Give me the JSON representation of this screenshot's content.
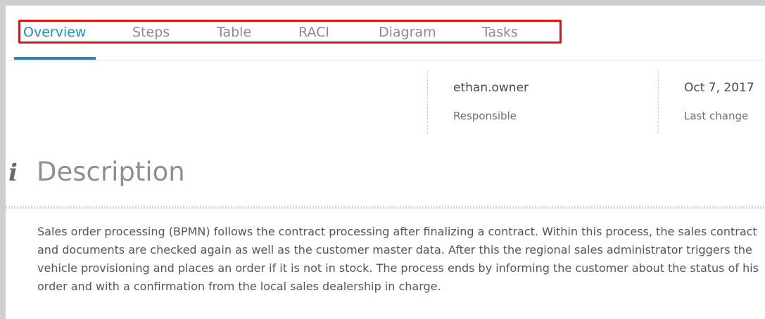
{
  "tabs": [
    {
      "label": "Overview",
      "active": true
    },
    {
      "label": "Steps",
      "active": false
    },
    {
      "label": "Table",
      "active": false
    },
    {
      "label": "RACI",
      "active": false
    },
    {
      "label": "Diagram",
      "active": false
    },
    {
      "label": "Tasks",
      "active": false
    }
  ],
  "meta": {
    "owner": {
      "value": "ethan.owner",
      "label": "Responsible"
    },
    "last_change": {
      "value": "Oct 7, 2017",
      "label": "Last change"
    }
  },
  "description": {
    "icon": "info-icon",
    "title": "Description",
    "text": "Sales order processing (BPMN) follows the contract processing after finalizing a contract. Within this process, the sales contract and documents are checked again as well as the customer master data. After this the regional sales administrator triggers the vehicle provisioning and places an order if it is not in stock. The process ends by informing the customer about the status of his order and with a confirmation from the local sales dealership in charge."
  },
  "colors": {
    "accent": "#1f8bbf",
    "highlight_border": "#e01616",
    "muted_text": "#8a8a8a"
  }
}
